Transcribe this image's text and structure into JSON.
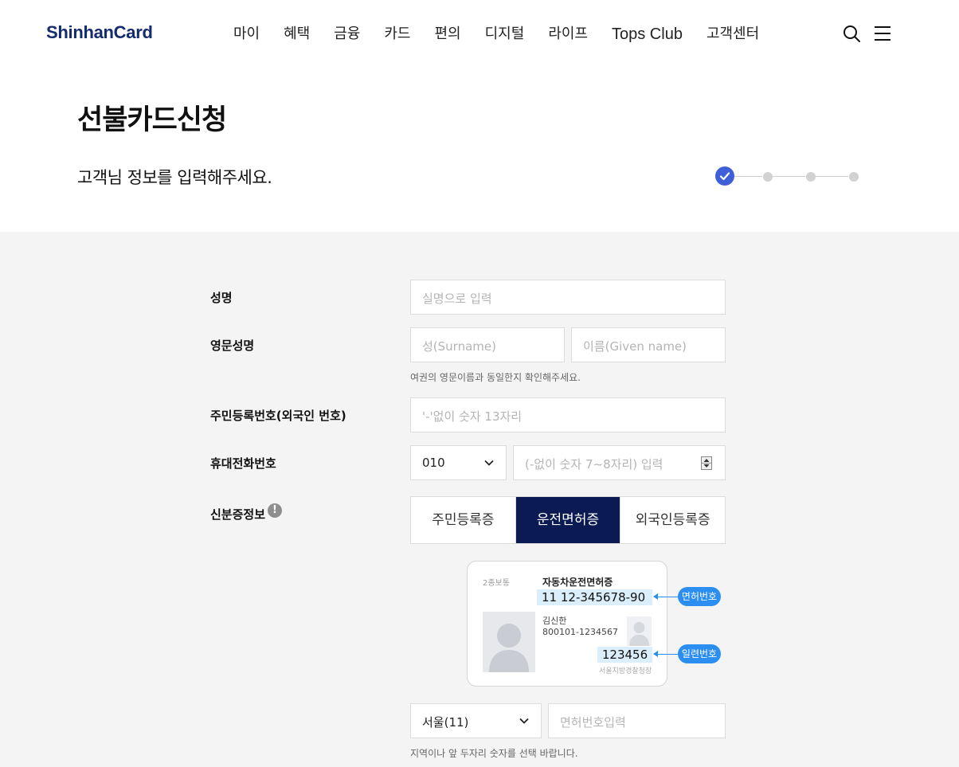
{
  "header": {
    "logo": "ShinhanCard",
    "nav": [
      "마이",
      "혜택",
      "금융",
      "카드",
      "편의",
      "디지털",
      "라이프",
      "Tops Club",
      "고객센터"
    ]
  },
  "page": {
    "title": "선불카드신청",
    "subtitle": "고객님 정보를 입력해주세요.",
    "steps": {
      "current": 1,
      "total": 4
    }
  },
  "form": {
    "name": {
      "label": "성명",
      "placeholder": "실명으로 입력"
    },
    "english_name": {
      "label": "영문성명",
      "surname_placeholder": "성(Surname)",
      "given_placeholder": "이름(Given name)",
      "helper": "여권의 영문이름과 동일한지 확인해주세요."
    },
    "rrn": {
      "label": "주민등록번호(외국인 번호)",
      "placeholder": "'-'없이 숫자 13자리"
    },
    "phone": {
      "label": "휴대전화번호",
      "prefix": "010",
      "placeholder": "(-없이 숫자 7~8자리) 입력"
    },
    "id_info": {
      "label": "신분증정보",
      "info_icon": "!",
      "tabs": [
        "주민등록증",
        "운전면허증",
        "외국인등록증"
      ],
      "selected": "운전면허증"
    },
    "license_card": {
      "class": "2종보통",
      "title": "자동차운전면허증",
      "number": "11 12-345678-90",
      "holder": "김신한",
      "holder_rrn": "800101-1234567",
      "serial": "123456",
      "issuer": "서울지방경찰청장",
      "number_tag": "면허번호",
      "serial_tag": "일련번호"
    },
    "license_region": {
      "selected": "서울(11)",
      "number_placeholder": "면허번호입력",
      "helper": "지역이나 앞 두자리 숫자를 선택 바랍니다."
    }
  },
  "colors": {
    "brand": "#142b6e",
    "active_tab": "#0b1a52",
    "step_active": "#3f5fd6",
    "tag": "#2b8ef0"
  }
}
